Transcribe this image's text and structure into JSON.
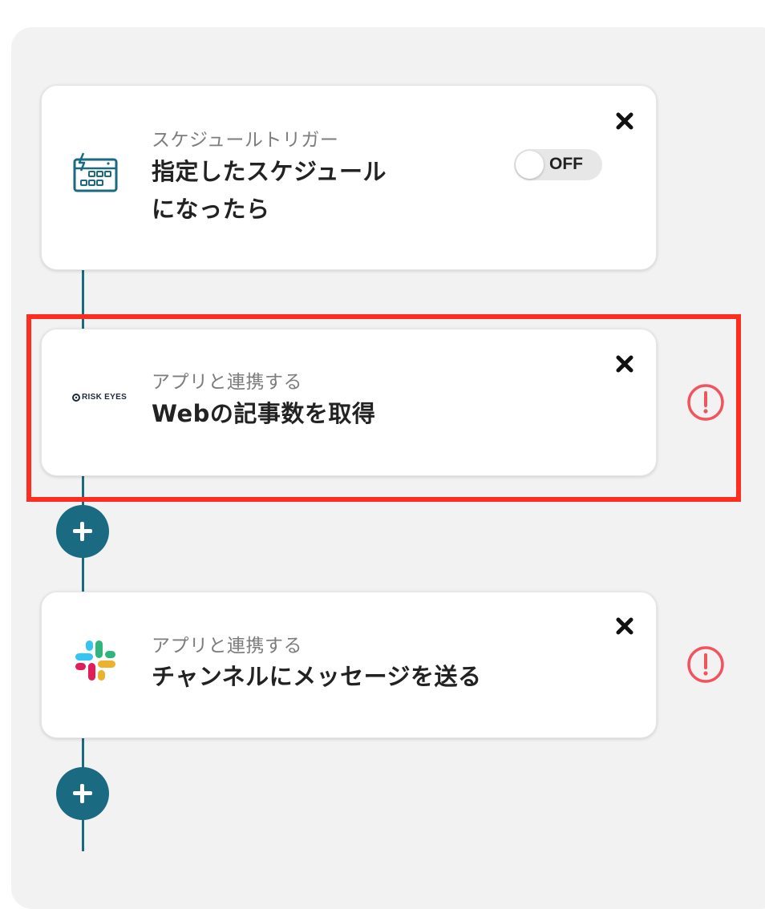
{
  "flow": {
    "steps": [
      {
        "subtitle": "スケジュールトリガー",
        "title_line1": "指定したスケジュール",
        "title_line2": "になったら",
        "icon": "schedule-calendar-icon",
        "toggle_label": "OFF"
      },
      {
        "subtitle": "アプリと連携する",
        "title": "Webの記事数を取得",
        "icon": "riskeyes-logo",
        "brand_text": "RISK EYES",
        "warning": true
      },
      {
        "subtitle": "アプリと連携する",
        "title": "チャンネルにメッセージを送る",
        "icon": "slack-logo",
        "warning": true
      }
    ]
  },
  "colors": {
    "line": "#1a6a82",
    "warning": "#f0545e",
    "highlight": "#ff2d20"
  }
}
